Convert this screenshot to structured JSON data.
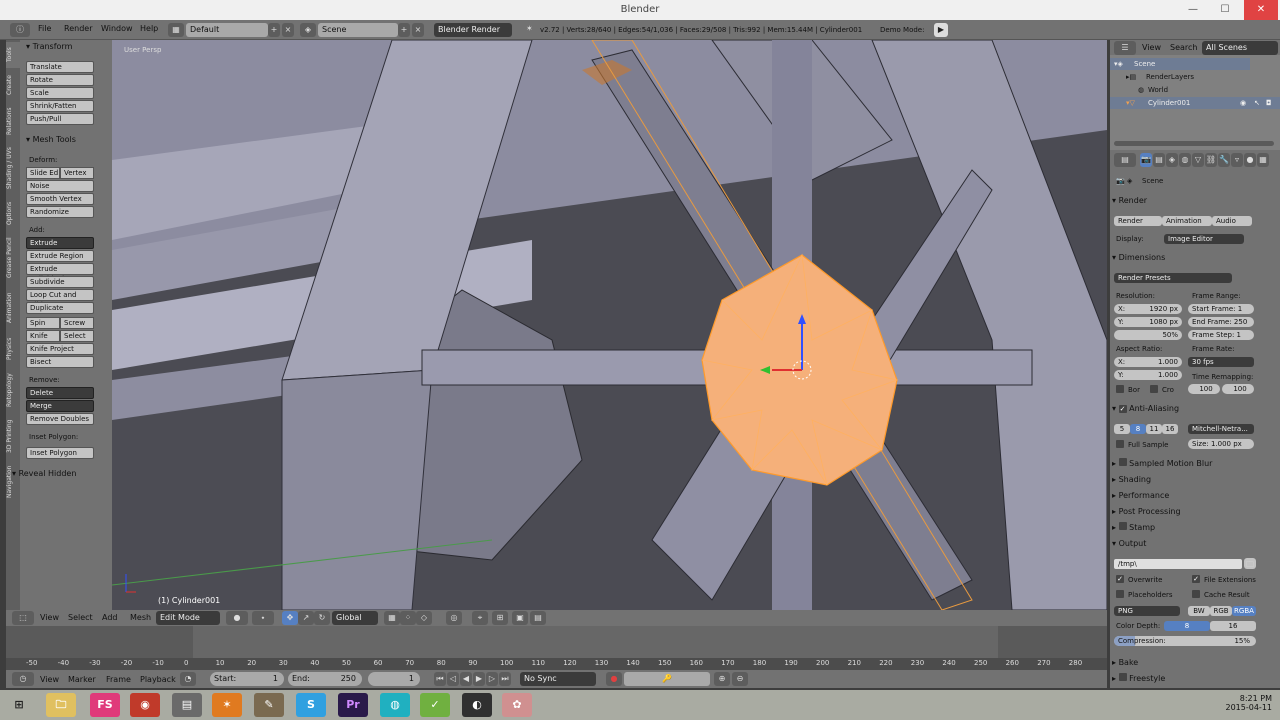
{
  "window": {
    "title": "Blender",
    "min": "—",
    "max": "☐",
    "close": "✕"
  },
  "topbar": {
    "menus": [
      "File",
      "Render",
      "Window",
      "Help"
    ],
    "layout": "Default",
    "scene": "Scene",
    "engine": "Blender Render",
    "stats": "v2.72 | Verts:28/640 | Edges:54/1,036 | Faces:29/508 | Tris:992 | Mem:15.44M | Cylinder001",
    "demo_mode": "Demo Mode:"
  },
  "toolshelf": {
    "tabs": [
      "Tools",
      "Create",
      "Relations",
      "Shading / UVs",
      "Options",
      "Grease Pencil",
      "Animation",
      "Physics",
      "Retopology",
      "3D Printing",
      "Navigation"
    ],
    "transform_header": "Transform",
    "transform": [
      "Translate",
      "Rotate",
      "Scale",
      "Shrink/Fatten",
      "Push/Pull"
    ],
    "mesh_tools_header": "Mesh Tools",
    "deform_label": "Deform:",
    "slide_edge": "Slide Ed",
    "vertex": "Vertex",
    "noise": "Noise",
    "smooth_vertex": "Smooth Vertex",
    "randomize": "Randomize",
    "add_label": "Add:",
    "extrude": "Extrude",
    "add_items": [
      "Extrude Region",
      "Extrude Individual",
      "Subdivide",
      "Loop Cut and Slide",
      "Duplicate"
    ],
    "spin": "Spin",
    "screw": "Screw",
    "knife": "Knife",
    "select": "Select",
    "knife_project": "Knife Project",
    "bisect": "Bisect",
    "remove_label": "Remove:",
    "delete": "Delete",
    "merge": "Merge",
    "remove_doubles": "Remove Doubles",
    "inset_label": "Inset Polygon:",
    "inset_polygon": "Inset Polygon",
    "reveal_hidden": "Reveal Hidden"
  },
  "viewport": {
    "label": "User Persp",
    "object": "(1) Cylinder001"
  },
  "vpheader": {
    "view": "View",
    "select": "Select",
    "add": "Add",
    "mesh": "Mesh",
    "mode": "Edit Mode",
    "orientation": "Global"
  },
  "timeline": {
    "ticks": [
      "-50",
      "-40",
      "-30",
      "-20",
      "-10",
      "0",
      "10",
      "20",
      "30",
      "40",
      "50",
      "60",
      "70",
      "80",
      "90",
      "100",
      "110",
      "120",
      "130",
      "140",
      "150",
      "160",
      "170",
      "180",
      "190",
      "200",
      "210",
      "220",
      "230",
      "240",
      "250",
      "260",
      "270",
      "280"
    ],
    "view": "View",
    "marker": "Marker",
    "frame": "Frame",
    "playback": "Playback",
    "start": "Start:",
    "start_val": "1",
    "end": "End:",
    "end_val": "250",
    "current": "1",
    "sync": "No Sync"
  },
  "outliner": {
    "view": "View",
    "search": "Search",
    "filter": "All Scenes",
    "items": [
      "Scene",
      "RenderLayers",
      "World",
      "Cylinder001"
    ]
  },
  "props": {
    "scene": "Scene",
    "render_header": "Render",
    "render_btn": "Render",
    "animation_btn": "Animation",
    "audio_btn": "Audio",
    "display_label": "Display:",
    "display_val": "Image Editor",
    "dimensions_header": "Dimensions",
    "render_presets": "Render Presets",
    "resolution_label": "Resolution:",
    "res_x": "X:",
    "res_x_val": "1920 px",
    "res_y": "Y:",
    "res_y_val": "1080 px",
    "res_pct": "50%",
    "frame_range_label": "Frame Range:",
    "start_frame": "Start Frame: 1",
    "end_frame": "End Frame: 250",
    "frame_step": "Frame Step: 1",
    "aspect_label": "Aspect Ratio:",
    "asp_x": "X:",
    "asp_x_val": "1.000",
    "asp_y": "Y:",
    "asp_y_val": "1.000",
    "frame_rate_label": "Frame Rate:",
    "fps": "30 fps",
    "bor": "Bor",
    "cro": "Cro",
    "time_remap_label": "Time Remapping:",
    "old": "100",
    "new": "100",
    "aa_header": "Anti-Aliasing",
    "aa_samples": [
      "5",
      "8",
      "11",
      "16"
    ],
    "aa_filter": "Mitchell-Netra...",
    "full_sample": "Full Sample",
    "aa_size": "Size: 1.000 px",
    "smb": "Sampled Motion Blur",
    "shading": "Shading",
    "performance": "Performance",
    "post_processing": "Post Processing",
    "stamp": "Stamp",
    "output_header": "Output",
    "output_path": "/tmp\\",
    "overwrite": "Overwrite",
    "file_ext": "File Extensions",
    "placeholders": "Placeholders",
    "cache_result": "Cache Result",
    "format": "PNG",
    "bw": "BW",
    "rgb": "RGB",
    "rgba": "RGBA",
    "color_depth": "Color Depth:",
    "depth8": "8",
    "depth16": "16",
    "compression": "Compression:",
    "compression_val": "15%",
    "bake": "Bake",
    "freestyle": "Freestyle"
  },
  "taskbar": {
    "time": "8:21 PM",
    "date": "2015-04-11"
  },
  "colors": {
    "accent": "#f0a050",
    "selection": "#5680c2",
    "bg": "#3d3d3d"
  }
}
